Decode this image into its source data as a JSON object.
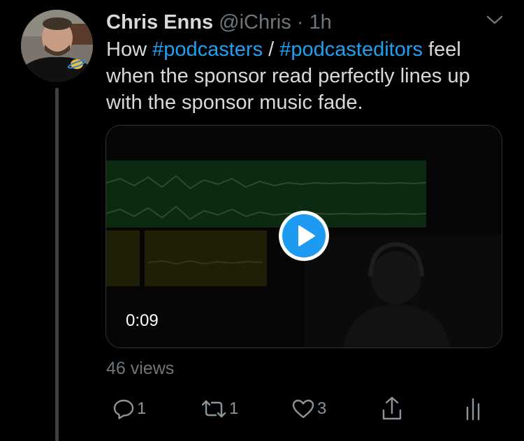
{
  "tweet": {
    "author_name": "Chris Enns",
    "handle": "@iChris",
    "separator": "·",
    "time": "1h",
    "text_parts": {
      "before": "How ",
      "hashtag1": "#podcasters",
      "middle": " / ",
      "hashtag2": "#podcasteditors",
      "after": " feel when the sponsor read perfectly lines up with the sponsor music fade."
    },
    "video": {
      "duration": "0:09"
    },
    "views": "46 views",
    "actions": {
      "reply_count": "1",
      "retweet_count": "1",
      "like_count": "3"
    }
  },
  "icons": {
    "menu": "chevron-down-icon",
    "play": "play-icon",
    "reply": "reply-icon",
    "retweet": "retweet-icon",
    "like": "heart-icon",
    "share": "share-icon",
    "analytics": "analytics-icon"
  },
  "colors": {
    "background": "#000000",
    "text": "#d9d9d9",
    "secondary_text": "#6e767d",
    "accent": "#1da1f2",
    "thread_line": "#3d4145"
  }
}
